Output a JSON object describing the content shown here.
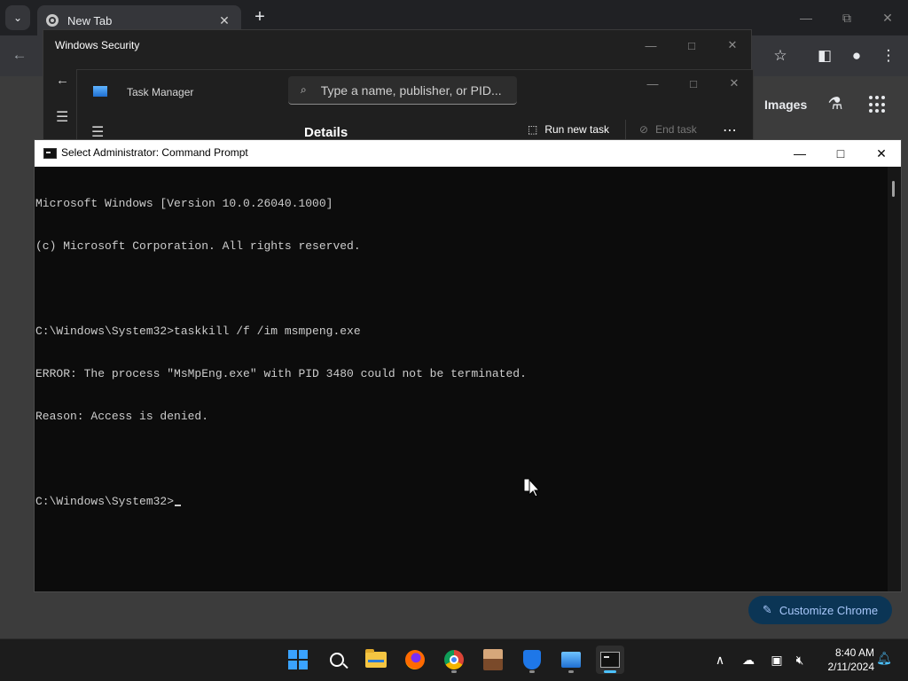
{
  "chrome": {
    "tab_title": "New Tab",
    "images_label": "Images",
    "customize_label": "Customize Chrome",
    "icons": {
      "tab_search": "chevron-down-icon",
      "tab_close": "close-icon",
      "new_tab": "plus-icon",
      "back": "back-arrow-icon",
      "bookmark": "star-icon",
      "side_panel": "side-panel-icon",
      "profile": "profile-icon",
      "menu": "kebab-menu-icon",
      "labs": "labs-flask-icon",
      "apps": "apps-grid-icon"
    }
  },
  "windows_security": {
    "title": "Windows Security"
  },
  "task_manager": {
    "title": "Task Manager",
    "search_placeholder": "Type a name, publisher, or PID...",
    "section_title": "Details",
    "run_new_task": "Run new task",
    "end_task": "End task"
  },
  "cmd": {
    "title": "Select Administrator: Command Prompt",
    "lines": [
      "Microsoft Windows [Version 10.0.26040.1000]",
      "(c) Microsoft Corporation. All rights reserved.",
      "",
      "C:\\Windows\\System32>taskkill /f /im msmpeng.exe",
      "ERROR: The process \"MsMpEng.exe\" with PID 3480 could not be terminated.",
      "Reason: Access is denied.",
      "",
      "C:\\Windows\\System32>"
    ]
  },
  "taskbar": {
    "apps": [
      "start",
      "search",
      "file-explorer",
      "firefox",
      "chrome",
      "app-avatar",
      "windows-security",
      "task-manager",
      "terminal"
    ],
    "active_app": "terminal",
    "time": "8:40 AM",
    "date": "2/11/2024"
  },
  "colors": {
    "accent": "#4cc2ff",
    "terminal_bg": "#0c0c0c",
    "terminal_text": "#cccccc",
    "customize_bg": "#0b3555"
  }
}
